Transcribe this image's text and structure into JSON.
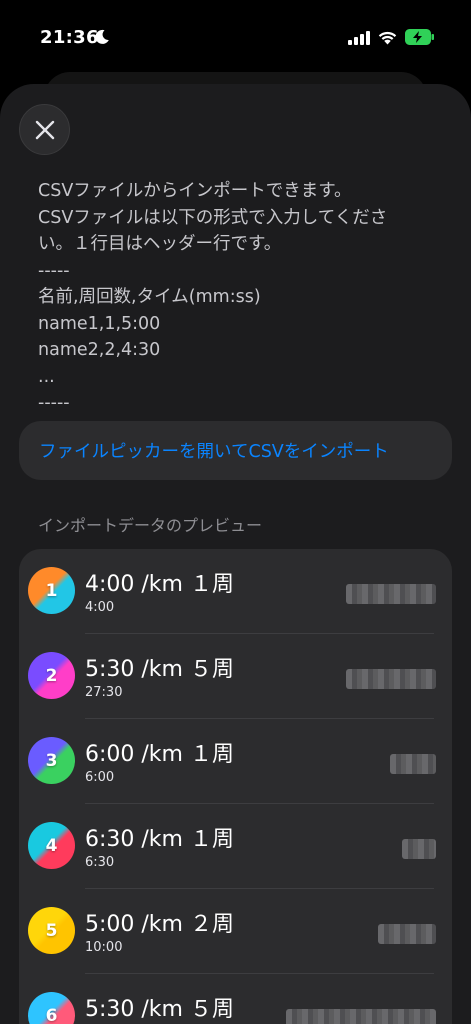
{
  "status_bar": {
    "time": "21:36"
  },
  "instructions": {
    "lines": [
      "CSVファイルからインポートできます。",
      "CSVファイルは以下の形式で入力してくださ",
      "い。１行目はヘッダー行です。",
      "-----",
      "名前,周回数,タイム(mm:ss)",
      "name1,1,5:00",
      "name2,2,4:30",
      "...",
      "-----"
    ]
  },
  "import_button": {
    "label": "ファイルピッカーを開いてCSVをインポート"
  },
  "preview": {
    "header": "インポートデータのプレビュー",
    "rows": [
      {
        "index": "1",
        "title": "4:00 /km １周",
        "subtitle": "4:00",
        "colors": [
          "#ff8a2a",
          "#22c6e6"
        ]
      },
      {
        "index": "2",
        "title": "5:30 /km ５周",
        "subtitle": "27:30",
        "colors": [
          "#7a4cff",
          "#ff3ec8"
        ]
      },
      {
        "index": "3",
        "title": "6:00 /km １周",
        "subtitle": "6:00",
        "colors": [
          "#6a5cff",
          "#3ad160"
        ]
      },
      {
        "index": "4",
        "title": "6:30 /km １周",
        "subtitle": "6:30",
        "colors": [
          "#19c9e0",
          "#ff3b5c"
        ]
      },
      {
        "index": "5",
        "title": "5:00 /km ２周",
        "subtitle": "10:00",
        "colors": [
          "#ffd60a",
          "#ffc400"
        ]
      },
      {
        "index": "6",
        "title": "5:30 /km ５周",
        "subtitle": "",
        "colors": [
          "#2ec4ff",
          "#ff5a7a"
        ]
      }
    ]
  }
}
